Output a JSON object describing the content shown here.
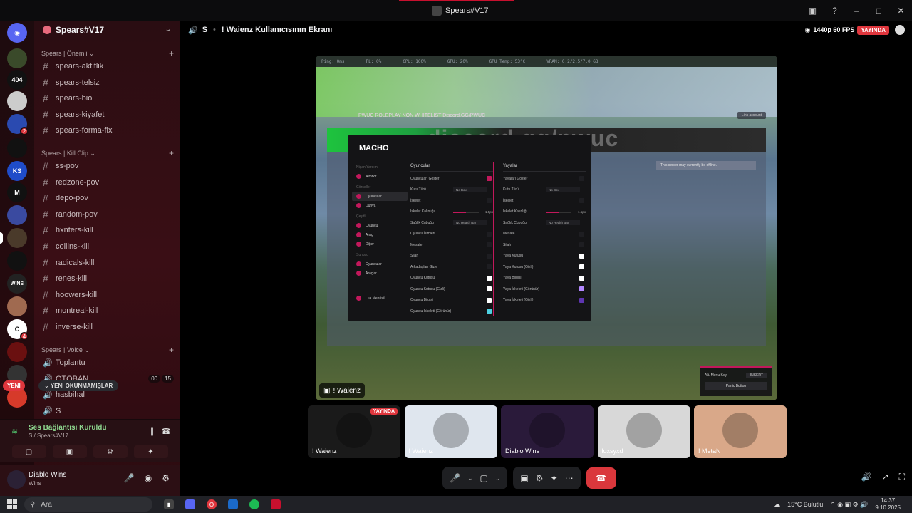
{
  "window": {
    "title": "Spears#V17"
  },
  "server": {
    "name": "Spears#V17",
    "categories": [
      {
        "name": "Spears | Önemli"
      },
      {
        "name": "Spears | Kill Clip"
      },
      {
        "name": "Spears | Voice"
      }
    ],
    "text_channels_important": [
      "spears-aktiflik",
      "spears-telsiz",
      "spears-bio",
      "spears-kiyafet",
      "spears-forma-fix"
    ],
    "text_channels_clip": [
      "ss-pov",
      "redzone-pov",
      "depo-pov",
      "random-pov",
      "hxnters-kill",
      "collins-kill",
      "radicals-kill",
      "renes-kill",
      "hoowers-kill",
      "montreal-kill",
      "inverse-kill"
    ],
    "voice_channels": [
      {
        "name": "Toplantu",
        "counts": []
      },
      {
        "name": "OTOBAN",
        "counts": [
          "00",
          "15"
        ]
      },
      {
        "name": "hasbihal",
        "counts": []
      },
      {
        "name": "S",
        "counts": []
      }
    ],
    "new_label": "YENİ",
    "unread_label": "YENİ OKUNMAMIŞLAR"
  },
  "rail": {
    "icons": [
      "discord-icon",
      "server-1",
      "server-404",
      "server-3",
      "server-4",
      "server-emergency",
      "server-ks",
      "server-m",
      "server-8",
      "server-9",
      "server-10",
      "server-wins",
      "server-12",
      "server-13",
      "server-14",
      "server-15",
      "server-16"
    ],
    "labels": {
      "s404": "404",
      "ks": "KS",
      "wins": "WINS"
    },
    "badges": [
      "2",
      "4"
    ]
  },
  "voice_panel": {
    "status": "Ses Bağlantısı Kuruldu",
    "sub": "S / Spears#V17"
  },
  "user": {
    "name": "Diablo Wins",
    "status": "Wins"
  },
  "stage": {
    "channel": "S",
    "title": "! Waienz Kullanıcısının Ekranı",
    "quality": "1440p 60 FPS",
    "live": "YAYINDA",
    "stream_owner": "! Waienz"
  },
  "game_screen": {
    "stats": [
      "Ping: 0ms",
      "PL: 0%",
      "CPU: 100%",
      "GPU: 20%",
      "GPU Temp: 53°C",
      "VRAM: 0.2/2.5/7.0 GB"
    ],
    "topbar": "PWUC ROLEPLAY NON WHITELIST Discord.GG/PWUC",
    "topbar_btn": "Link account",
    "banner": "discord.gg/pwuc",
    "notice": "This server may currently be offline.",
    "menu": {
      "title": "MACHO",
      "sections": [
        {
          "title": "Nişan Yardımı",
          "items": [
            "Aimbot"
          ]
        },
        {
          "title": "Görseller",
          "items": [
            "Oyuncular",
            "Dünya"
          ]
        },
        {
          "title": "Çeşitli",
          "items": [
            "Oyuncu",
            "Araç",
            "Diğer"
          ]
        },
        {
          "title": "Sunucu",
          "items": [
            "Oyuncular",
            "Araçlar"
          ]
        },
        {
          "title": "",
          "items": [
            "Lua Menüsü"
          ]
        }
      ],
      "left_column": {
        "header": "Oyuncular",
        "rows": [
          {
            "label": "Oyuncuları Göster",
            "type": "check",
            "color": "#c2185b"
          },
          {
            "label": "Kutu Türü",
            "type": "value",
            "value": "No Box"
          },
          {
            "label": "İskelet",
            "type": "check",
            "color": "#1e1e22"
          },
          {
            "label": "İskelet Kalınlığı",
            "type": "slider",
            "value": "1.5px",
            "fill": 0.5
          },
          {
            "label": "Sağlık Çubuğu",
            "type": "value",
            "value": "No Health Bar"
          },
          {
            "label": "Oyuncu İsimleri",
            "type": "check",
            "color": "#1e1e22"
          },
          {
            "label": "Mesafe",
            "type": "check",
            "color": "#1e1e22"
          },
          {
            "label": "Silah",
            "type": "check",
            "color": "#1e1e22"
          },
          {
            "label": "Arkadaşları Gizle",
            "type": "check",
            "color": "#1e1e22"
          },
          {
            "label": "Oyuncu Kutusu",
            "type": "check",
            "color": "#ffffff"
          },
          {
            "label": "Oyuncu Kutusu (Gizli)",
            "type": "check",
            "color": "#ffffff"
          },
          {
            "label": "Oyuncu Bilgisi",
            "type": "check",
            "color": "#ffffff"
          },
          {
            "label": "Oyuncu İskeleti (Görünür)",
            "type": "check",
            "color": "#4dd0e1"
          }
        ]
      },
      "right_column": {
        "header": "Yayalar",
        "rows": [
          {
            "label": "Yayaları Göster",
            "type": "check",
            "color": "#1e1e22"
          },
          {
            "label": "Kutu Türü",
            "type": "value",
            "value": "No Box"
          },
          {
            "label": "İskelet",
            "type": "check",
            "color": "#1e1e22"
          },
          {
            "label": "İskelet Kalınlığı",
            "type": "slider",
            "value": "1.5px",
            "fill": 0.5
          },
          {
            "label": "Sağlık Çubuğu",
            "type": "value",
            "value": "No Health Bar"
          },
          {
            "label": "Mesafe",
            "type": "check",
            "color": "#1e1e22"
          },
          {
            "label": "Silah",
            "type": "check",
            "color": "#1e1e22"
          },
          {
            "label": "Yaya Kutusu",
            "type": "check",
            "color": "#ffffff"
          },
          {
            "label": "Yaya Kutusu (Gizli)",
            "type": "check",
            "color": "#ffffff"
          },
          {
            "label": "Yaya Bilgisi",
            "type": "check",
            "color": "#ffffff"
          },
          {
            "label": "Yaya İskeleti (Görünür)",
            "type": "check",
            "color": "#b388ff"
          },
          {
            "label": "Yaya İskeleti (Gizli)",
            "type": "check",
            "color": "#5e35b1"
          }
        ]
      }
    },
    "keypanel": {
      "label": "Alt. Menu Key",
      "key": "INSERT",
      "button": "Panic Button"
    }
  },
  "tiles": [
    {
      "name": "! Waienz",
      "live": "YAYINDA",
      "bg": "#1a1a1a"
    },
    {
      "name": "! Waienz",
      "live": "",
      "bg": "#dfe6ee"
    },
    {
      "name": "Diablo Wins",
      "live": "",
      "bg": "#2a1a3a"
    },
    {
      "name": "loxsyxd",
      "live": "",
      "bg": "#d8d8d8"
    },
    {
      "name": "! MetaN",
      "live": "",
      "bg": "#d9a889"
    }
  ],
  "taskbar": {
    "search": "Ara",
    "weather": "15°C  Bulutlu",
    "time": "14:37",
    "date": "9.10.2025"
  },
  "colors": {
    "live": "#e0363d",
    "accent": "#c2185b",
    "hangup": "#da373c"
  }
}
